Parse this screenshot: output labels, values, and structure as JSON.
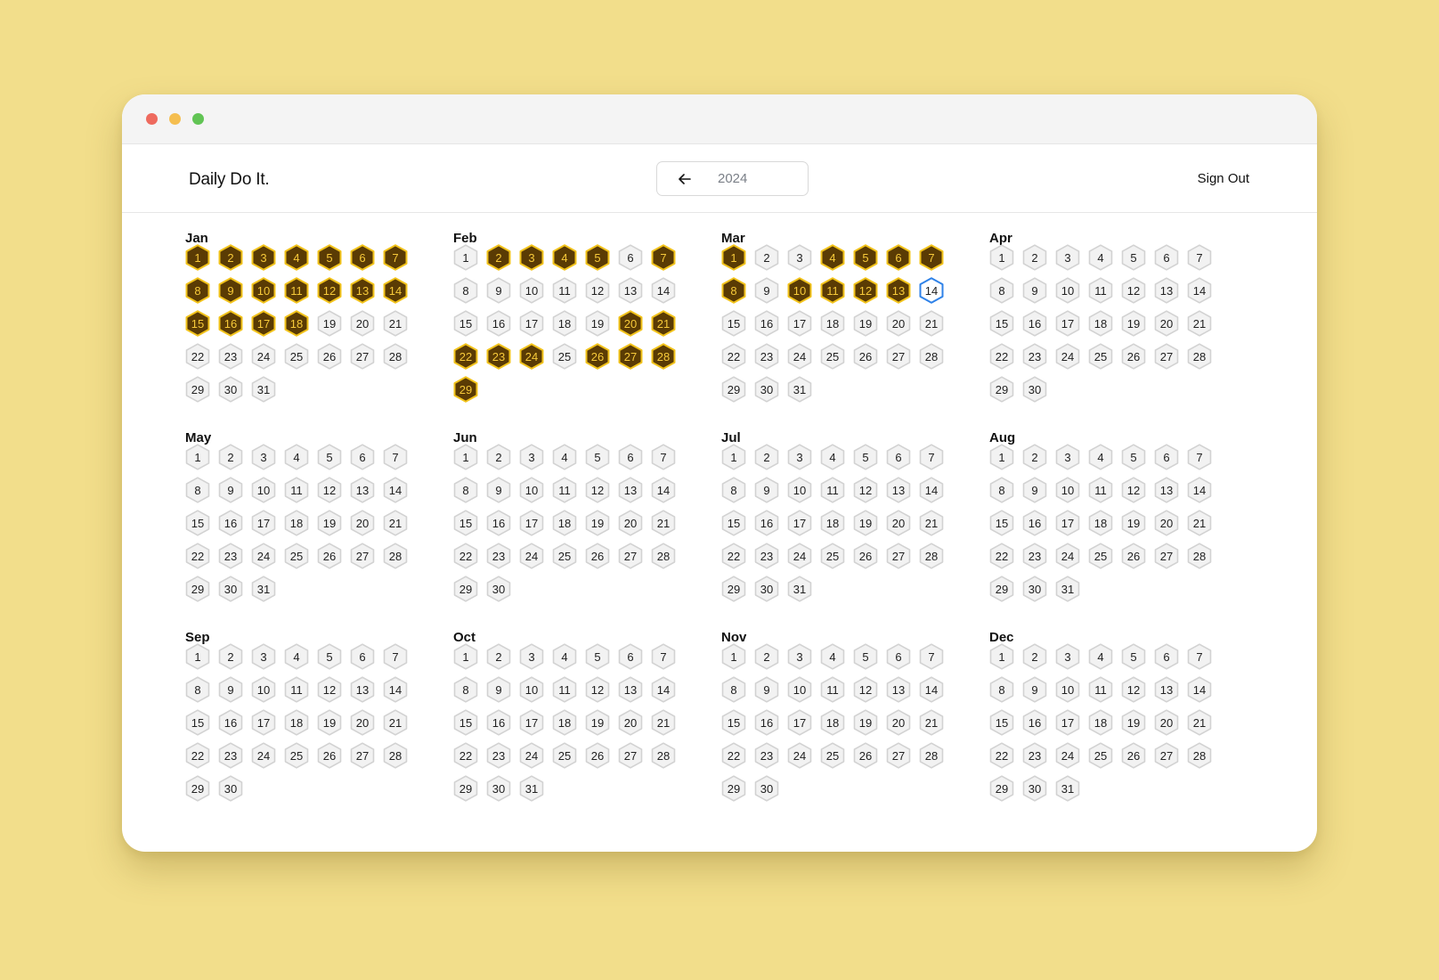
{
  "window": {
    "controls": [
      "close",
      "minimize",
      "maximize"
    ]
  },
  "header": {
    "brand": "Daily Do It.",
    "back_icon": "arrow-left-icon",
    "year": "2024",
    "sign_out": "Sign Out"
  },
  "colors": {
    "page_background": "#f2de8b",
    "done_fill": "#5a3b04",
    "done_stroke": "#f2c31b",
    "done_text": "#f6c93a",
    "empty_fill": "#f2f2f2",
    "empty_stroke": "#d2d2d2",
    "today_stroke": "#2f82e8"
  },
  "months": [
    {
      "name": "Jan",
      "days": 31,
      "done": [
        1,
        2,
        3,
        4,
        5,
        6,
        7,
        8,
        9,
        10,
        11,
        12,
        13,
        14,
        15,
        16,
        17,
        18
      ]
    },
    {
      "name": "Feb",
      "days": 29,
      "done": [
        2,
        3,
        4,
        5,
        7,
        20,
        21,
        22,
        23,
        24,
        26,
        27,
        28,
        29
      ]
    },
    {
      "name": "Mar",
      "days": 31,
      "done": [
        1,
        4,
        5,
        6,
        7,
        8,
        10,
        11,
        12,
        13
      ],
      "today": 14
    },
    {
      "name": "Apr",
      "days": 30,
      "done": []
    },
    {
      "name": "May",
      "days": 31,
      "done": []
    },
    {
      "name": "Jun",
      "days": 30,
      "done": []
    },
    {
      "name": "Jul",
      "days": 31,
      "done": []
    },
    {
      "name": "Aug",
      "days": 31,
      "done": []
    },
    {
      "name": "Sep",
      "days": 30,
      "done": []
    },
    {
      "name": "Oct",
      "days": 31,
      "done": []
    },
    {
      "name": "Nov",
      "days": 30,
      "done": []
    },
    {
      "name": "Dec",
      "days": 31,
      "done": []
    }
  ]
}
